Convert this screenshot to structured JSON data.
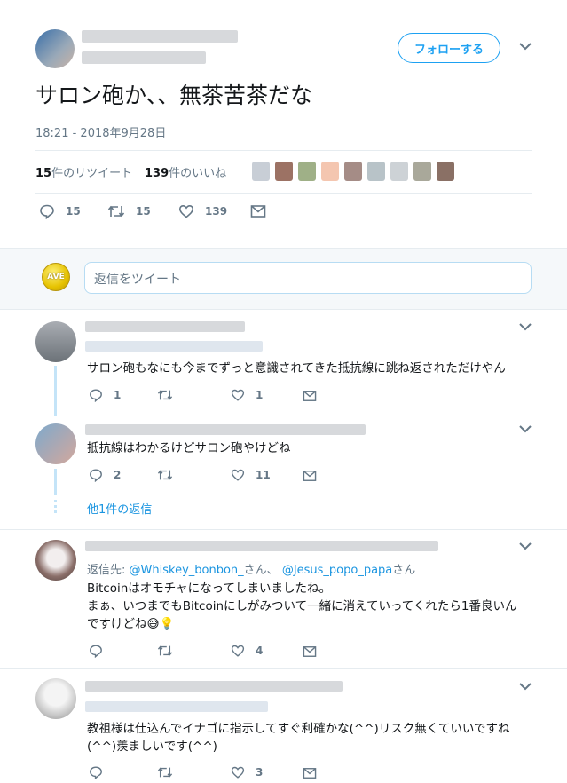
{
  "main_tweet": {
    "follow_label": "フォローする",
    "text": "サロン砲か、、無茶苦茶だな",
    "timestamp": "18:21 - 2018年9月28日",
    "retweet_count": "15",
    "retweet_label": "件のリツイート",
    "like_count": "139",
    "like_label": "件のいいね",
    "actions": {
      "reply": "15",
      "retweet": "15",
      "like": "139"
    }
  },
  "reply_box": {
    "avatar_text": "AVE",
    "placeholder": "返信をツイート"
  },
  "replies": [
    {
      "text": "サロン砲もなにも今までずっと意識されてきた抵抗線に跳ね返されただけやん",
      "reply": "1",
      "retweet": "",
      "like": "1"
    },
    {
      "text": "抵抗線はわかるけどサロン砲やけどね",
      "reply": "2",
      "retweet": "",
      "like": "11",
      "more_replies": "他1件の返信"
    },
    {
      "reply_to_prefix": "返信先:",
      "reply_to_user1": "@Whiskey_bonbon_",
      "reply_to_mid": "さん、",
      "reply_to_user2": "@Jesus_popo_papa",
      "reply_to_suffix": "さん",
      "line1": "Bitcoinはオモチャになってしまいましたね。",
      "line2": "まぁ、いつまでもBitcoinにしがみついて一緒に消えていってくれたら1番良いん",
      "line3": "ですけどね😅💡",
      "reply": "",
      "retweet": "",
      "like": "4"
    },
    {
      "line1": "教祖様は仕込んでイナゴに指示してすぐ利確かな(^^)リスク無くていいですね",
      "line2": "(^^)羨ましいです(^^)",
      "reply": "",
      "retweet": "",
      "like": "3"
    }
  ],
  "colors": {
    "accent": "#1da1f2",
    "link": "#1b95e0",
    "muted": "#657786",
    "thread_line": "#c4e4f8"
  },
  "icons": [
    "chevron-down-icon",
    "reply-icon",
    "retweet-icon",
    "like-icon",
    "message-icon"
  ]
}
